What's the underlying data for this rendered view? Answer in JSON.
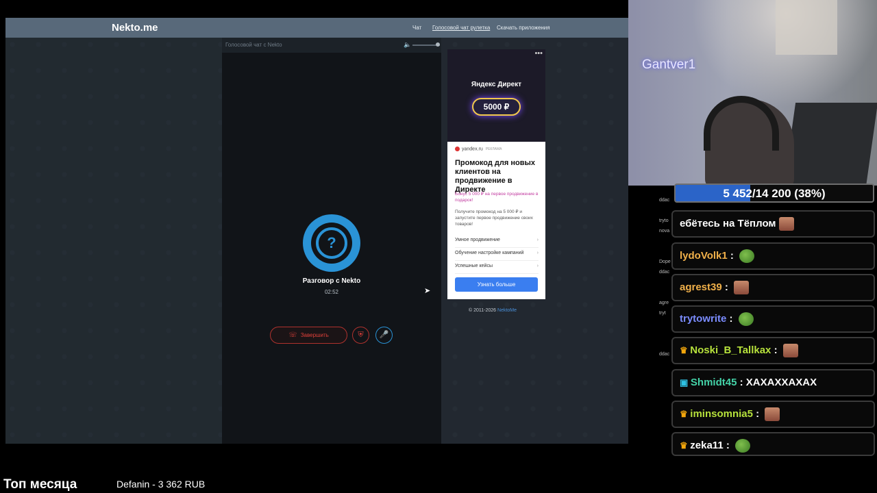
{
  "site": {
    "logo": "Nekto.me",
    "nav": [
      "Чат",
      "Голосовой чат рулетка",
      "Скачать приложения"
    ]
  },
  "voice_panel": {
    "header_title": "Голосовой чат с Nekto",
    "avatar_glyph": "?",
    "conversation_title": "Разговор с Nekto",
    "timer": "02:52",
    "end_button": "Завершить",
    "end_icon": "phone-hangup-icon",
    "shield_icon": "shield-icon",
    "mic_icon": "microphone-icon",
    "volume_level": 1.0
  },
  "ad": {
    "brand": "Яндекс Директ",
    "amount": "5000 ₽",
    "domain": "yandex.ru",
    "domain_tag": "РЕКЛАМА",
    "headline": "Промокод для новых клиентов на продвижение в Директе",
    "bonus": "Бонус 5 000 ₽ на первое продвижение в подарок!",
    "body": "Получите промокод на 5 000 ₽ и запустите первое продвижение своих товаров!",
    "links": [
      "Умное продвижение",
      "Обучение настройке кампаний",
      "Успешные кейсы"
    ],
    "cta": "Узнать больше",
    "menu_glyph": "•••"
  },
  "copyright": {
    "text": "© 2011-2026",
    "link": "NektoMe"
  },
  "webcam": {
    "streamer_name": "Gantver1"
  },
  "goal": {
    "text": "5 452/14 200 (38%)",
    "progress": 0.38
  },
  "mini_chat": [
    "",
    "ddac",
    "",
    "tryto",
    "nova",
    "",
    "",
    "Dope",
    "ddac",
    "",
    "",
    "agre",
    "tryt",
    "",
    "",
    "",
    "ddac"
  ],
  "chat": [
    {
      "user": "",
      "user_color": "#ffffff",
      "badge": "",
      "text": "ебётесь на Тёплом",
      "emote": "face"
    },
    {
      "user": "lydoVolk1",
      "user_color": "#f0b04a",
      "badge": "",
      "text": "",
      "emote": "pepe"
    },
    {
      "user": "agrest39",
      "user_color": "#f0b04a",
      "badge": "",
      "text": "",
      "emote": "face"
    },
    {
      "user": "trytowrite",
      "user_color": "#7b8cff",
      "badge": "",
      "text": "",
      "emote": "pepe"
    },
    {
      "user": "Noski_B_Tallkax",
      "user_color": "#b7e23c",
      "badge": "crown",
      "text": "",
      "emote": "face"
    },
    {
      "user": "Shmidt45",
      "user_color": "#44d3a8",
      "badge": "gg",
      "text": "ХАХАХХАХАХ",
      "emote": ""
    },
    {
      "user": "iminsomnia5",
      "user_color": "#b7e23c",
      "badge": "crown",
      "text": "",
      "emote": "face"
    },
    {
      "user": "zeka11",
      "user_color": "#ffffff",
      "badge": "crown",
      "text": "",
      "emote": "pepe"
    }
  ],
  "bottom": {
    "title": "Топ месяца",
    "donor": "Defanin - 3 362 RUB"
  }
}
